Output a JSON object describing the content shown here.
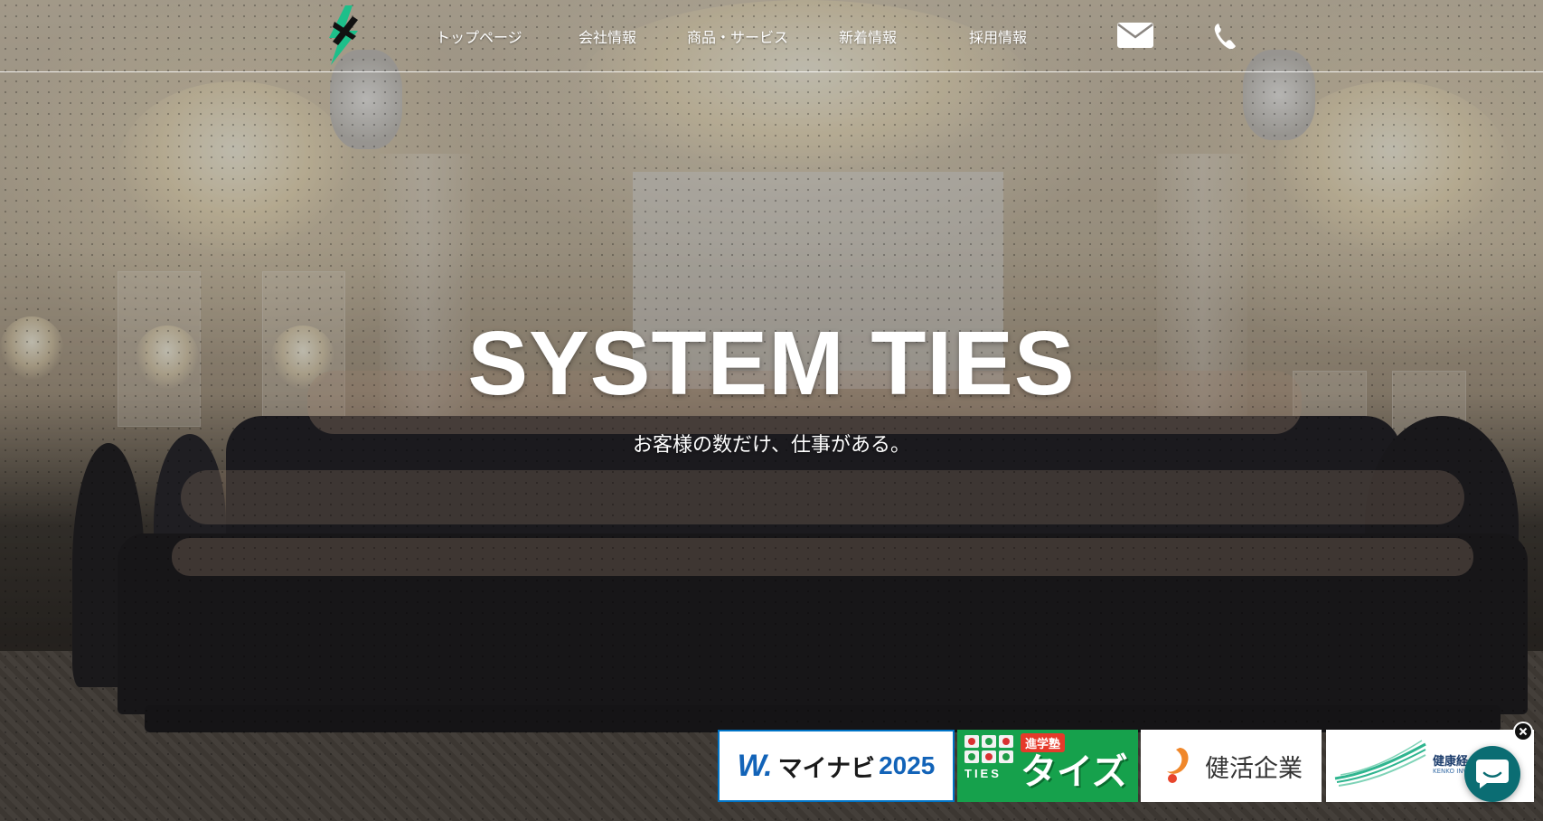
{
  "header": {
    "logo": {
      "name": "system-ties-logo",
      "colors": {
        "green": "#1dbf8a",
        "dark": "#111111"
      }
    },
    "nav": [
      {
        "id": "top",
        "label": "トップページ"
      },
      {
        "id": "company",
        "label": "会社情報"
      },
      {
        "id": "products",
        "label": "商品・サービス"
      },
      {
        "id": "news",
        "label": "新着情報"
      },
      {
        "id": "recruit",
        "label": "採用情報"
      }
    ],
    "icons": {
      "mail": "mail-icon",
      "phone": "phone-icon"
    }
  },
  "hero": {
    "title": "SYSTEM TIES",
    "tagline": "お客様の数だけ、仕事がある。",
    "background": "group-photo"
  },
  "banners": {
    "mynavi": {
      "mark": "W.",
      "text": "マイナビ",
      "year": "2025",
      "accent": "#1263b8"
    },
    "ties": {
      "badge": "進学塾",
      "brand": "TIES",
      "name": "タイズ",
      "color": "#16a14c"
    },
    "kenkatsu": {
      "text": "健活企業",
      "accent": "#f0872a"
    },
    "kenkou": {
      "text": "健康経",
      "sub": "KENKO INV",
      "accent": "#2fb58f"
    }
  },
  "widgets": {
    "close": "close-icon",
    "chat": "chat-bubble-icon",
    "chat_color": "#0b6d73"
  }
}
